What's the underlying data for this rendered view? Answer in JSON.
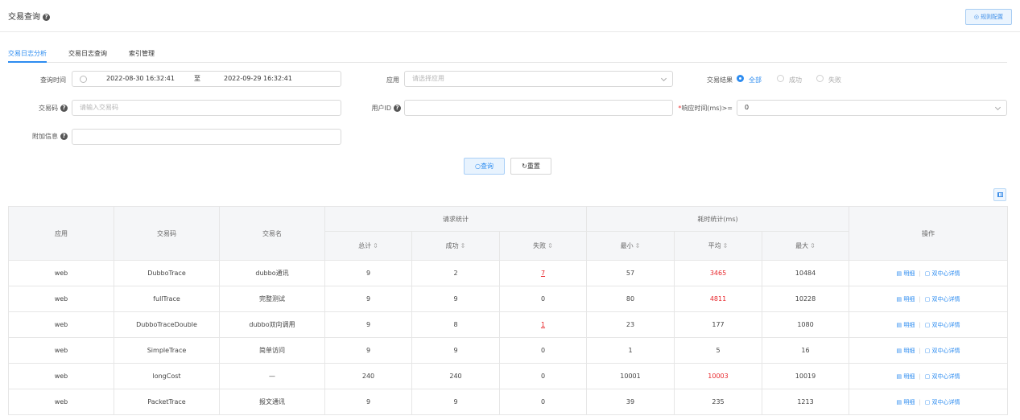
{
  "header": {
    "title": "交易查询",
    "rule_button": "◎ 规则配置"
  },
  "tabs": [
    "交易日志分析",
    "交易日志查询",
    "索引管理"
  ],
  "filters": {
    "time_label": "查询时间",
    "time_start": "2022-08-30 16:32:41",
    "time_sep": "至",
    "time_end": "2022-09-29 16:32:41",
    "app_label": "应用",
    "app_placeholder": "请选择应用",
    "result_label": "交易结果",
    "result_options": [
      "全部",
      "成功",
      "失败"
    ],
    "code_label": "交易码",
    "code_placeholder": "请输入交易码",
    "user_label": "用户ID",
    "resp_label": "响应时间(ms)>=",
    "resp_value": "0",
    "extra_label": "附加信息",
    "query_button": "查询",
    "reset_button": "重置"
  },
  "table": {
    "headers": {
      "app": "应用",
      "code": "交易码",
      "name": "交易名",
      "req_group": "请求统计",
      "time_group": "耗时统计(ms)",
      "ops": "操作",
      "total": "总计",
      "success": "成功",
      "fail": "失败",
      "min": "最小",
      "avg": "平均",
      "max": "最大"
    },
    "op_detail": "明细",
    "op_dual": "双中心详情",
    "rows": [
      {
        "app": "web",
        "code": "DubboTrace",
        "name": "dubbo通讯",
        "total": "9",
        "success": "2",
        "fail": "7",
        "min": "57",
        "avg": "3465",
        "max": "10484"
      },
      {
        "app": "web",
        "code": "fullTrace",
        "name": "完整测试",
        "total": "9",
        "success": "9",
        "fail": "0",
        "min": "80",
        "avg": "4811",
        "max": "10228"
      },
      {
        "app": "web",
        "code": "DubboTraceDouble",
        "name": "dubbo双向调用",
        "total": "9",
        "success": "8",
        "fail": "1",
        "min": "23",
        "avg": "177",
        "max": "1080"
      },
      {
        "app": "web",
        "code": "SimpleTrace",
        "name": "简单访问",
        "total": "9",
        "success": "9",
        "fail": "0",
        "min": "1",
        "avg": "5",
        "max": "16"
      },
      {
        "app": "web",
        "code": "longCost",
        "name": "—",
        "total": "240",
        "success": "240",
        "fail": "0",
        "min": "10001",
        "avg": "10003",
        "max": "10019"
      },
      {
        "app": "web",
        "code": "PacketTrace",
        "name": "报文通讯",
        "total": "9",
        "success": "9",
        "fail": "0",
        "min": "39",
        "avg": "235",
        "max": "1213"
      }
    ],
    "red_fail_rows": [
      0,
      2
    ],
    "red_avg_rows": [
      0,
      1,
      4
    ]
  },
  "colors": {
    "primary": "#2d8cf0",
    "danger": "#e8262b"
  }
}
